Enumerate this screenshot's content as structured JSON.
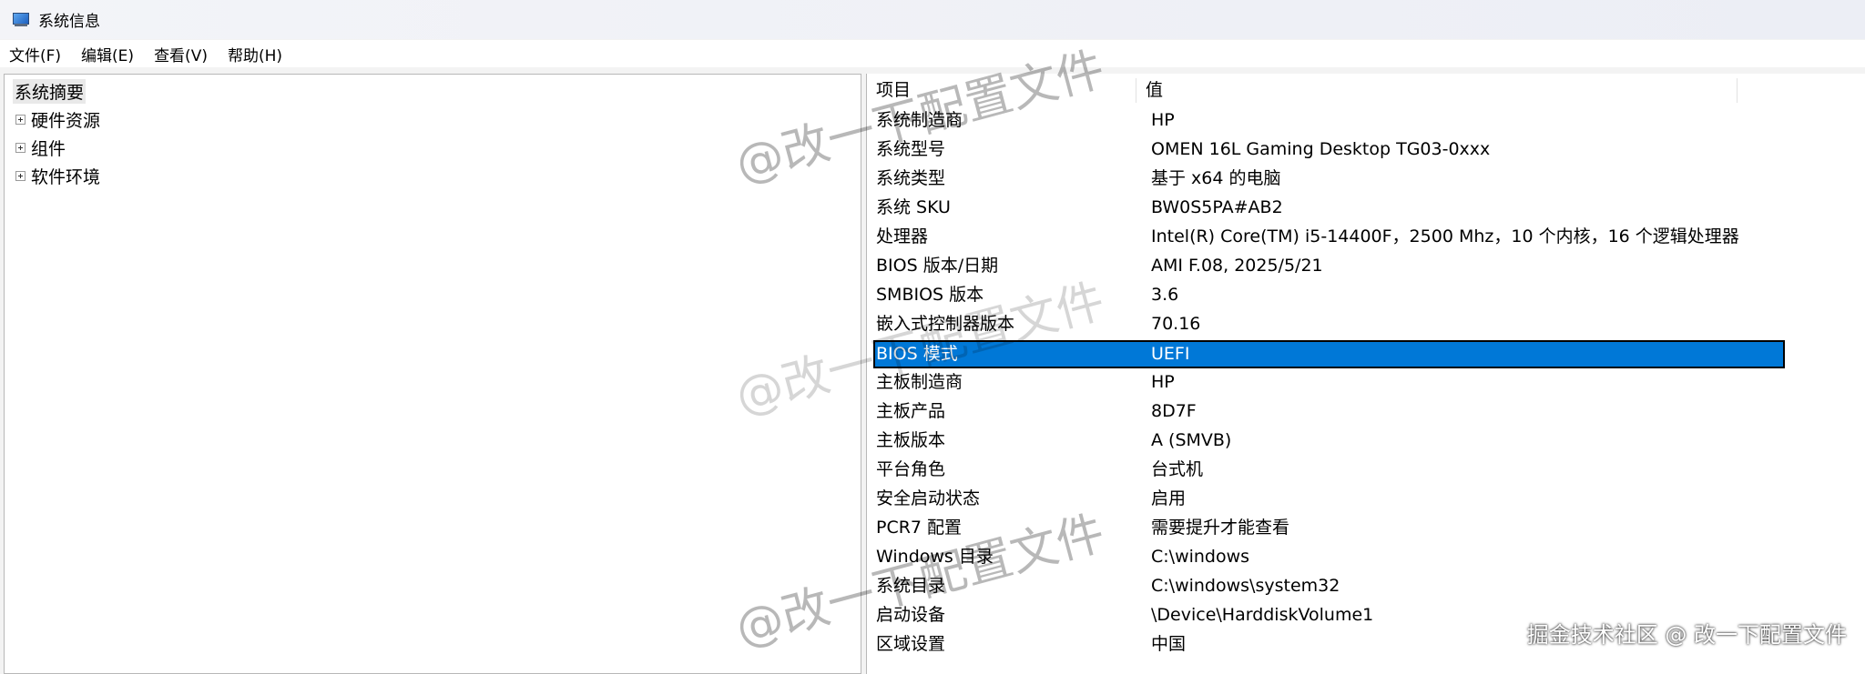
{
  "window": {
    "title": "系统信息",
    "icon": "system-info-icon"
  },
  "menu": [
    "文件(F)",
    "编辑(E)",
    "查看(V)",
    "帮助(H)"
  ],
  "tree": {
    "root": "系统摘要",
    "items": [
      "硬件资源",
      "组件",
      "软件环境"
    ]
  },
  "table": {
    "headers": {
      "item": "项目",
      "value": "值"
    },
    "rows": [
      {
        "key": "系统制造商",
        "value": "HP"
      },
      {
        "key": "系统型号",
        "value": "OMEN 16L Gaming Desktop TG03-0xxx"
      },
      {
        "key": "系统类型",
        "value": "基于 x64 的电脑"
      },
      {
        "key": "系统 SKU",
        "value": "BW0S5PA#AB2"
      },
      {
        "key": "处理器",
        "value": "Intel(R) Core(TM) i5-14400F，2500 Mhz，10 个内核，16 个逻辑处理器"
      },
      {
        "key": "BIOS 版本/日期",
        "value": "AMI F.08, 2025/5/21"
      },
      {
        "key": "SMBIOS 版本",
        "value": "3.6"
      },
      {
        "key": "嵌入式控制器版本",
        "value": "70.16"
      },
      {
        "key": "BIOS 模式",
        "value": "UEFI"
      },
      {
        "key": "主板制造商",
        "value": "HP"
      },
      {
        "key": "主板产品",
        "value": "8D7F"
      },
      {
        "key": "主板版本",
        "value": "A (SMVB)"
      },
      {
        "key": "平台角色",
        "value": "台式机"
      },
      {
        "key": "安全启动状态",
        "value": "启用"
      },
      {
        "key": "PCR7 配置",
        "value": "需要提升才能查看"
      },
      {
        "key": "Windows 目录",
        "value": "C:\\windows"
      },
      {
        "key": "系统目录",
        "value": "C:\\windows\\system32"
      },
      {
        "key": "启动设备",
        "value": "\\Device\\HarddiskVolume1"
      },
      {
        "key": "区域设置",
        "value": "中国"
      }
    ],
    "selected_row": "BIOS 模式"
  },
  "watermark": "@改一下配置文件",
  "footer_watermark": "掘金技术社区 @ 改一下配置文件",
  "colors": {
    "selection": "#0078d7",
    "window_bg": "#f3f3f3"
  }
}
